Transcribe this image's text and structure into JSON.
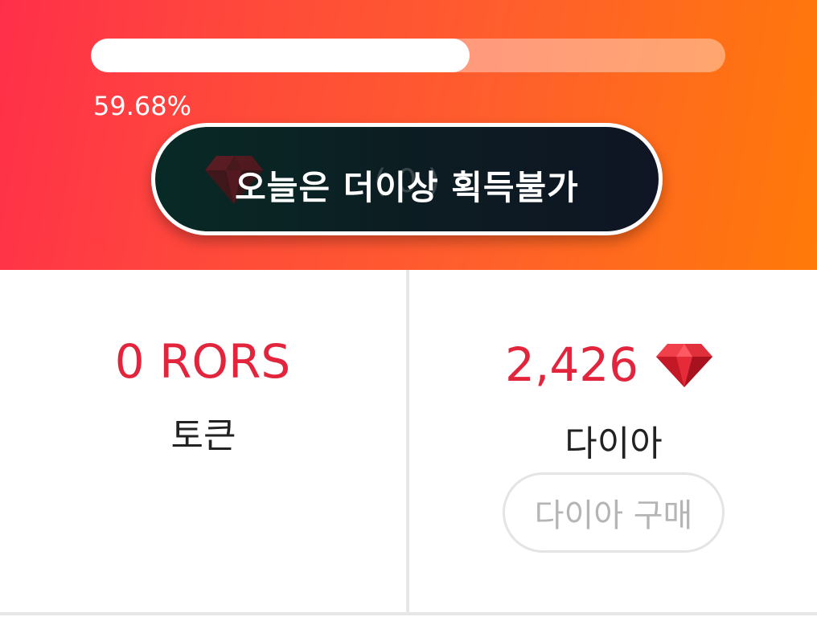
{
  "banner": {
    "progress": {
      "fraction": 0.5968,
      "label": "59.68%"
    },
    "action_button": {
      "label": "오늘은 더이상 획득불가",
      "faded_text": "( 0 )"
    }
  },
  "stats": {
    "tokens": {
      "value": "0 RORS",
      "label": "토큰"
    },
    "diamonds": {
      "value": "2,426",
      "label": "다이아",
      "buy_label": "다이아 구매",
      "icon": "ruby-gem-icon"
    }
  },
  "colors": {
    "accent_red": "#e2253c",
    "banner_start": "#ff2f4a",
    "banner_end": "#ff7a08",
    "button_dark": "#0c1d22",
    "gem_red": "#d6202f"
  }
}
